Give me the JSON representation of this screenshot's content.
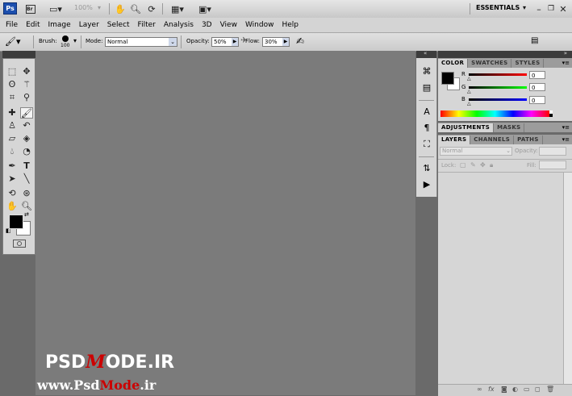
{
  "appbar": {
    "ps_logo": "Ps",
    "zoom": "100%",
    "workspace": "ESSENTIALS"
  },
  "menu": [
    "File",
    "Edit",
    "Image",
    "Layer",
    "Select",
    "Filter",
    "Analysis",
    "3D",
    "View",
    "Window",
    "Help"
  ],
  "options": {
    "brush_label": "Brush:",
    "brush_size": "100",
    "mode_label": "Mode:",
    "mode_value": "Normal",
    "opacity_label": "Opacity:",
    "opacity_value": "50%",
    "flow_label": "Flow:",
    "flow_value": "30%"
  },
  "color_panel": {
    "tabs": [
      "COLOR",
      "SWATCHES",
      "STYLES"
    ],
    "r_label": "R",
    "r_value": "0",
    "g_label": "G",
    "g_value": "0",
    "b_label": "B",
    "b_value": "0"
  },
  "adjust_panel": {
    "tabs": [
      "ADJUSTMENTS",
      "MASKS"
    ]
  },
  "layers_panel": {
    "tabs": [
      "LAYERS",
      "CHANNELS",
      "PATHS"
    ],
    "blend_mode": "Normal",
    "opacity_label": "Opacity:",
    "lock_label": "Lock:",
    "fill_label": "Fill:"
  },
  "watermark": {
    "line1_a": "PSD",
    "line1_b": "ODE.IR",
    "line2_a": "www.Psd",
    "line2_b": "Mode",
    "line2_c": ".ir"
  },
  "colors": {
    "foreground": "#000000",
    "background": "#ffffff",
    "accent": "#1c4fae"
  }
}
